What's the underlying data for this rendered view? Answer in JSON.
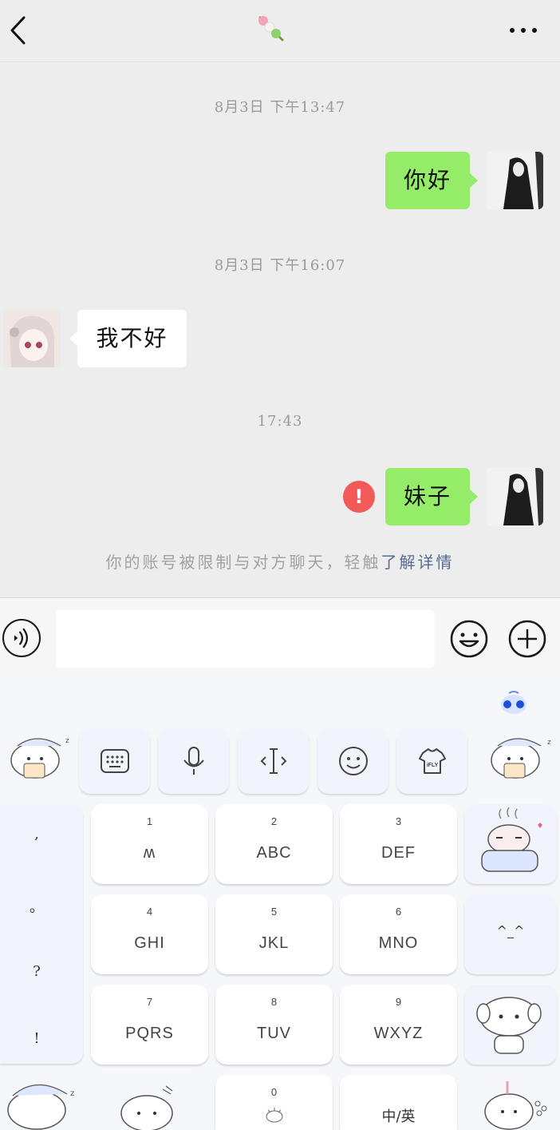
{
  "header": {
    "title_icon": "dango-emoji-icon",
    "back_icon": "chevron-left-icon",
    "more_icon": "more-dots-icon"
  },
  "chat": {
    "timestamps": [
      "8月3日 下午13:47",
      "8月3日 下午16:07",
      "17:43"
    ],
    "messages": [
      {
        "from": "me",
        "text": "你好"
      },
      {
        "from": "other",
        "text": "我不好"
      },
      {
        "from": "me",
        "text": "妹子",
        "status": "!"
      }
    ],
    "notice_text": "你的账号被限制与对方聊天，轻触",
    "notice_link": "了解详情"
  },
  "input_bar": {
    "input_value": "",
    "voice_icon": "voice-icon",
    "emoji_icon": "emoji-icon",
    "plus_icon": "plus-icon"
  },
  "keyboard": {
    "toolbar_icons": [
      "keyboard-icon",
      "microphone-icon",
      "cursor-icon",
      "smiley-icon",
      "ifly-skin-icon"
    ],
    "skin_label": "iFLY",
    "punctuation": [
      ",",
      "。",
      "?",
      "!"
    ],
    "keys": [
      {
        "num": "1",
        "letters": "ʍ"
      },
      {
        "num": "2",
        "letters": "ABC"
      },
      {
        "num": "3",
        "letters": "DEF"
      },
      {
        "num": "4",
        "letters": "GHI"
      },
      {
        "num": "5",
        "letters": "JKL"
      },
      {
        "num": "6",
        "letters": "MNO"
      },
      {
        "num": "7",
        "letters": "PQRS"
      },
      {
        "num": "8",
        "letters": "TUV"
      },
      {
        "num": "9",
        "letters": "WXYZ"
      },
      {
        "num": "0",
        "letters": ""
      }
    ],
    "face_key": "^_^",
    "lang_key": "中/英"
  },
  "colors": {
    "sent_bubble": "#95ec69",
    "received_bubble": "#ffffff",
    "error": "#f25a5a",
    "link": "#576b95",
    "background": "#ededed"
  }
}
